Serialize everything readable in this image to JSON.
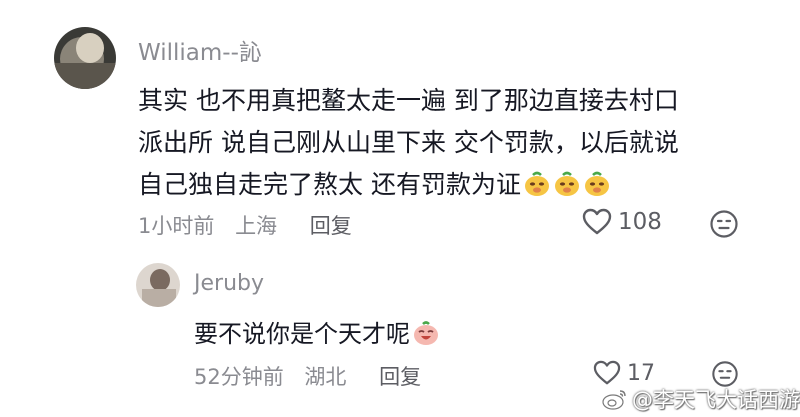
{
  "comment": {
    "username": "William--訫",
    "lines": [
      "其实 也不用真把鳌太走一遍   到了那边直接去村口",
      "派出所  说自己刚从山里下来 交个罚款，以后就说",
      "自己独自走完了熬太   还有罚款为证"
    ],
    "emojis": [
      "doge-emoji",
      "doge-emoji",
      "doge-emoji"
    ],
    "time": "1小时前",
    "location": "上海",
    "reply_label": "回复",
    "likes": "108"
  },
  "reply": {
    "username": "Jeruby",
    "text": "要不说你是个天才呢",
    "emoji": "laugh-emoji",
    "time": "52分钟前",
    "location": "湖北",
    "reply_label": "回复",
    "likes": "17"
  },
  "watermark": "@李天飞大话西游",
  "colors": {
    "secondary_text": "#8a8b91",
    "primary_text": "#161823",
    "emoji_yellow": "#f6c544",
    "emoji_pink": "#f5b8b0"
  },
  "icons": [
    "heart-icon",
    "dislike-face-icon",
    "weibo-logo-icon"
  ]
}
